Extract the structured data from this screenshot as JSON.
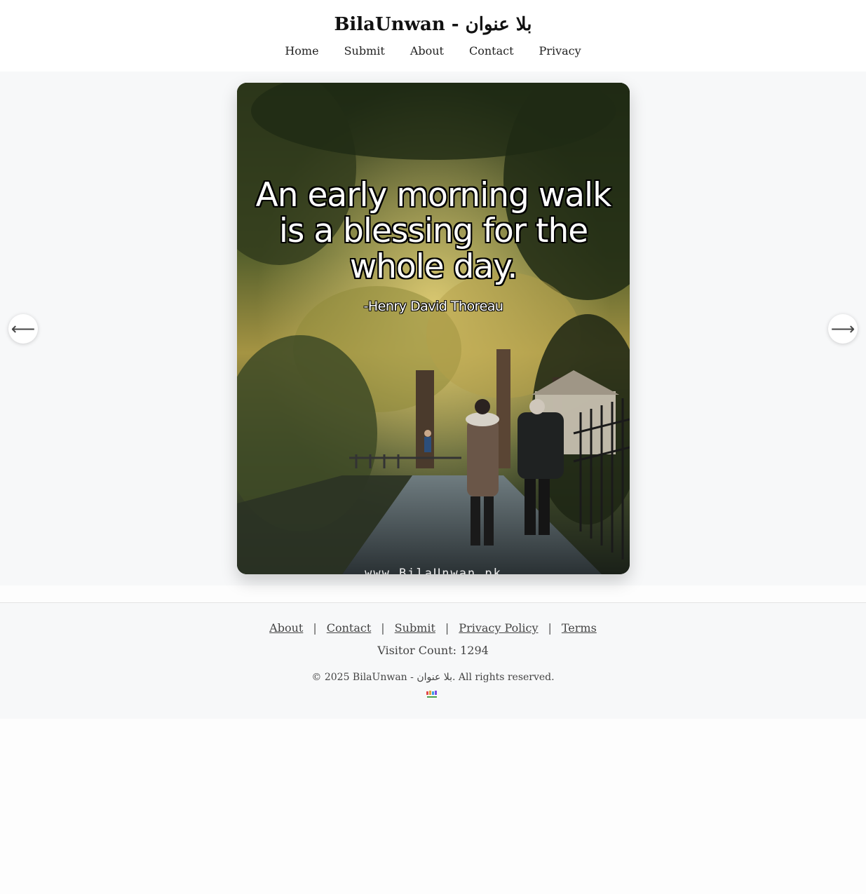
{
  "header": {
    "title": "BilaUnwan - بلا عنوان",
    "nav": [
      "Home",
      "Submit",
      "About",
      "Contact",
      "Privacy"
    ]
  },
  "slide": {
    "quote": "An early morning walk is a blessing for the whole day.",
    "author": "-Henry David Thoreau",
    "watermark": "www.BilaUnwan.pk"
  },
  "controls": {
    "prev_icon": "left-arrow-icon",
    "prev_glyph": "⟵",
    "next_icon": "right-arrow-icon",
    "next_glyph": "⟶"
  },
  "footer": {
    "links": [
      "About",
      "Contact",
      "Submit",
      "Privacy Policy",
      "Terms"
    ],
    "separator": "|",
    "visitor_count": "Visitor Count: 1294",
    "copyright": "© 2025 BilaUnwan - بلا عنوان. All rights reserved.",
    "logo_icon": "bilaunwan-logo-icon"
  }
}
